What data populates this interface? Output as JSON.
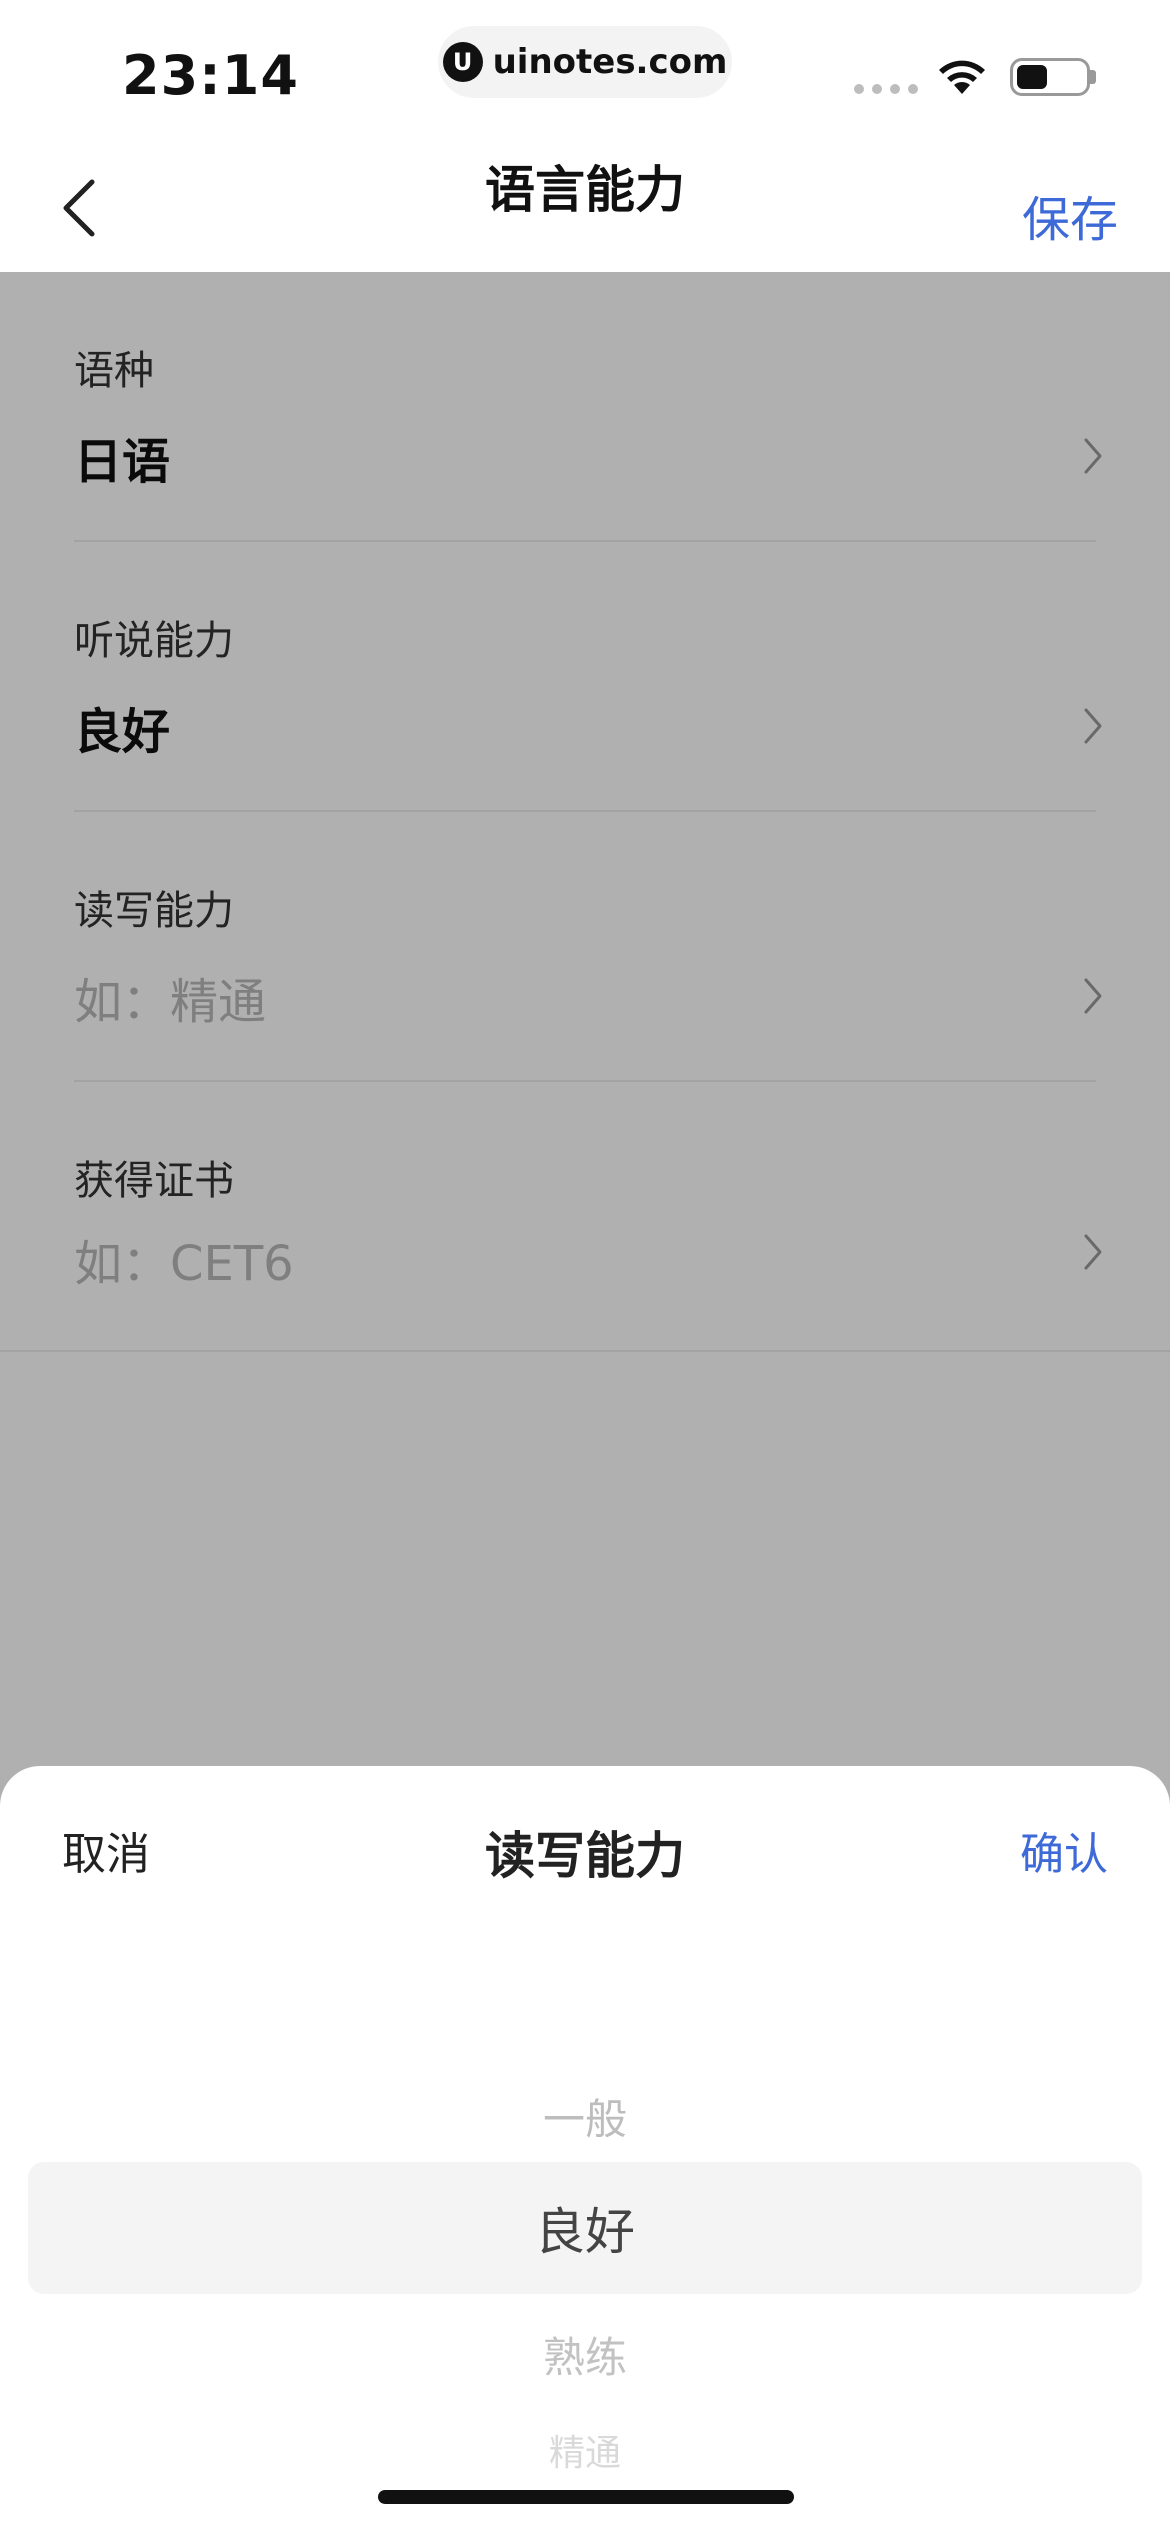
{
  "status_bar": {
    "time": "23:14",
    "url": "uinotes.com",
    "url_logo_glyph": "U"
  },
  "nav": {
    "back_icon": "chevron-left-icon",
    "title": "语言能力",
    "save_label": "保存"
  },
  "form": {
    "rows": [
      {
        "label": "语种",
        "value": "日语"
      },
      {
        "label": "听说能力",
        "value": "良好"
      },
      {
        "label": "读写能力",
        "placeholder": "如：精通"
      },
      {
        "label": "获得证书",
        "placeholder": "如：CET6"
      }
    ]
  },
  "sheet": {
    "cancel_label": "取消",
    "title": "读写能力",
    "confirm_label": "确认",
    "options": [
      "一般",
      "良好",
      "熟练",
      "精通"
    ],
    "selected": "良好"
  },
  "colors": {
    "accent": "#3e6ad8",
    "overlay": "rgba(0,0,0,0.31)"
  }
}
